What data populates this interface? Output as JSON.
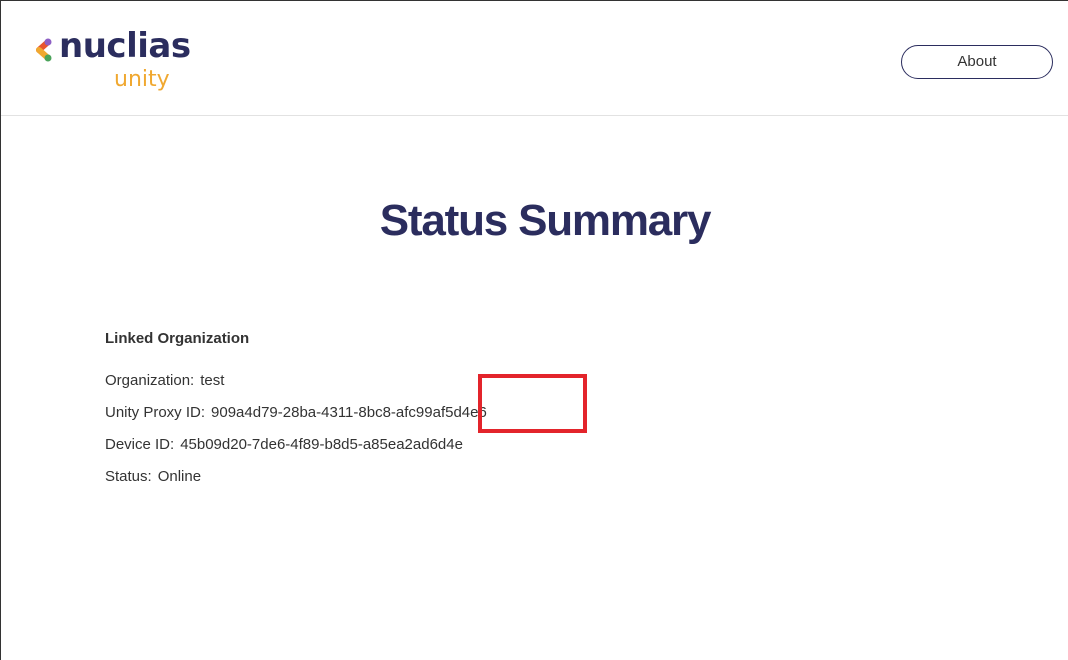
{
  "colors": {
    "brand_navy": "#2b2d5e",
    "brand_orange": "#f0a830",
    "text": "#333333",
    "highlight": "#e3242b"
  },
  "header": {
    "logo": {
      "word": "nuclias",
      "sub": "unity",
      "icon": "chevron-dots-logo-icon"
    },
    "about_label": "About"
  },
  "main": {
    "title": "Status Summary",
    "section_title": "Linked Organization",
    "rows": [
      {
        "label": "Organization:",
        "value": "test"
      },
      {
        "label": "Unity Proxy ID:",
        "value": "909a4d79-28ba-4311-8bc8-afc99af5d4e6"
      },
      {
        "label": "Device ID:",
        "value": "45b09d20-7de6-4f89-b8d5-a85ea2ad6d4e"
      },
      {
        "label": "Status:",
        "value": "Online"
      }
    ]
  }
}
